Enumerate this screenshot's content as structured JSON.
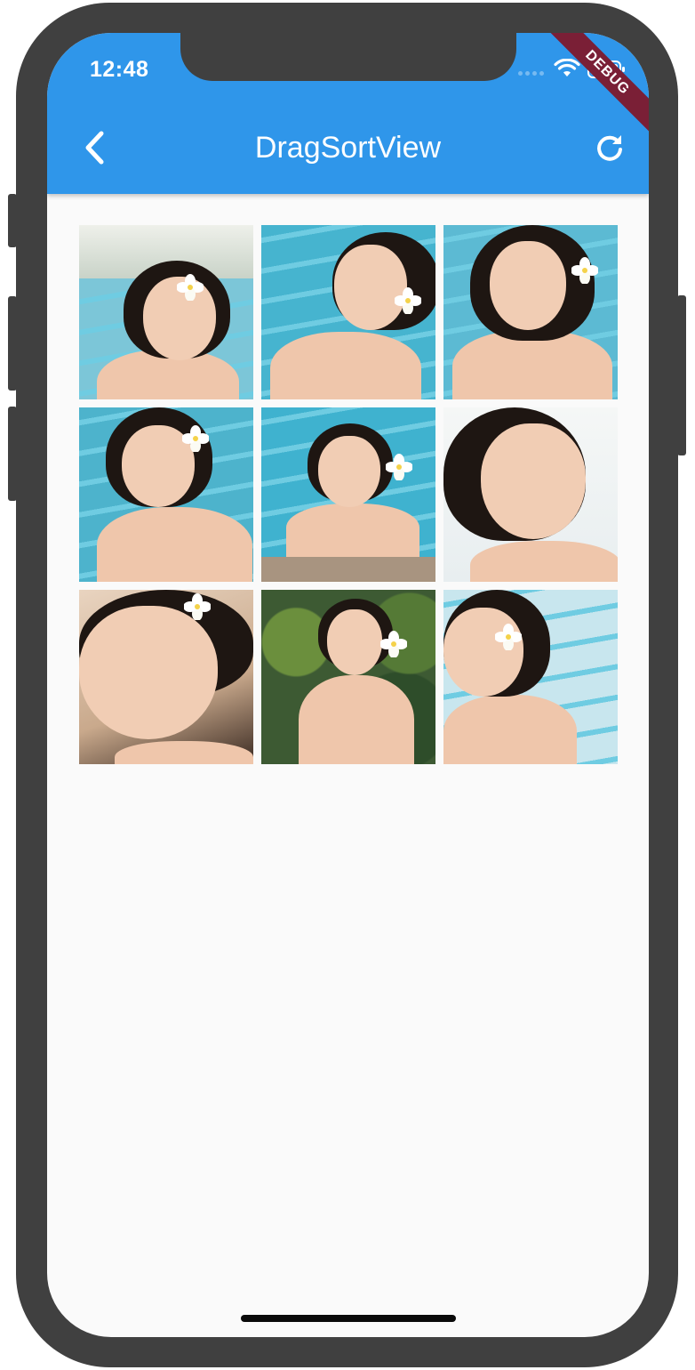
{
  "status_bar": {
    "time": "12:48",
    "debug_label": "DEBUG"
  },
  "app_bar": {
    "title": "DragSortView",
    "back_icon": "chevron-left-icon",
    "action_icon": "refresh-icon",
    "color": "#2f96ea"
  },
  "gallery": {
    "photos": [
      {
        "scene": "pool-resort",
        "bg": "#7cc6d8"
      },
      {
        "scene": "pool-water",
        "bg": "#46b4cf"
      },
      {
        "scene": "pool-water",
        "bg": "#5cbad3"
      },
      {
        "scene": "pool-water",
        "bg": "#4db3cc"
      },
      {
        "scene": "pool-water",
        "bg": "#3fb2cf"
      },
      {
        "scene": "bright-outdoor",
        "bg": "#e8eef0"
      },
      {
        "scene": "close-up",
        "bg": "#c9a98c"
      },
      {
        "scene": "tropical-leaves",
        "bg": "#3d5a33"
      },
      {
        "scene": "pool-side",
        "bg": "#c8e6ee"
      }
    ]
  }
}
